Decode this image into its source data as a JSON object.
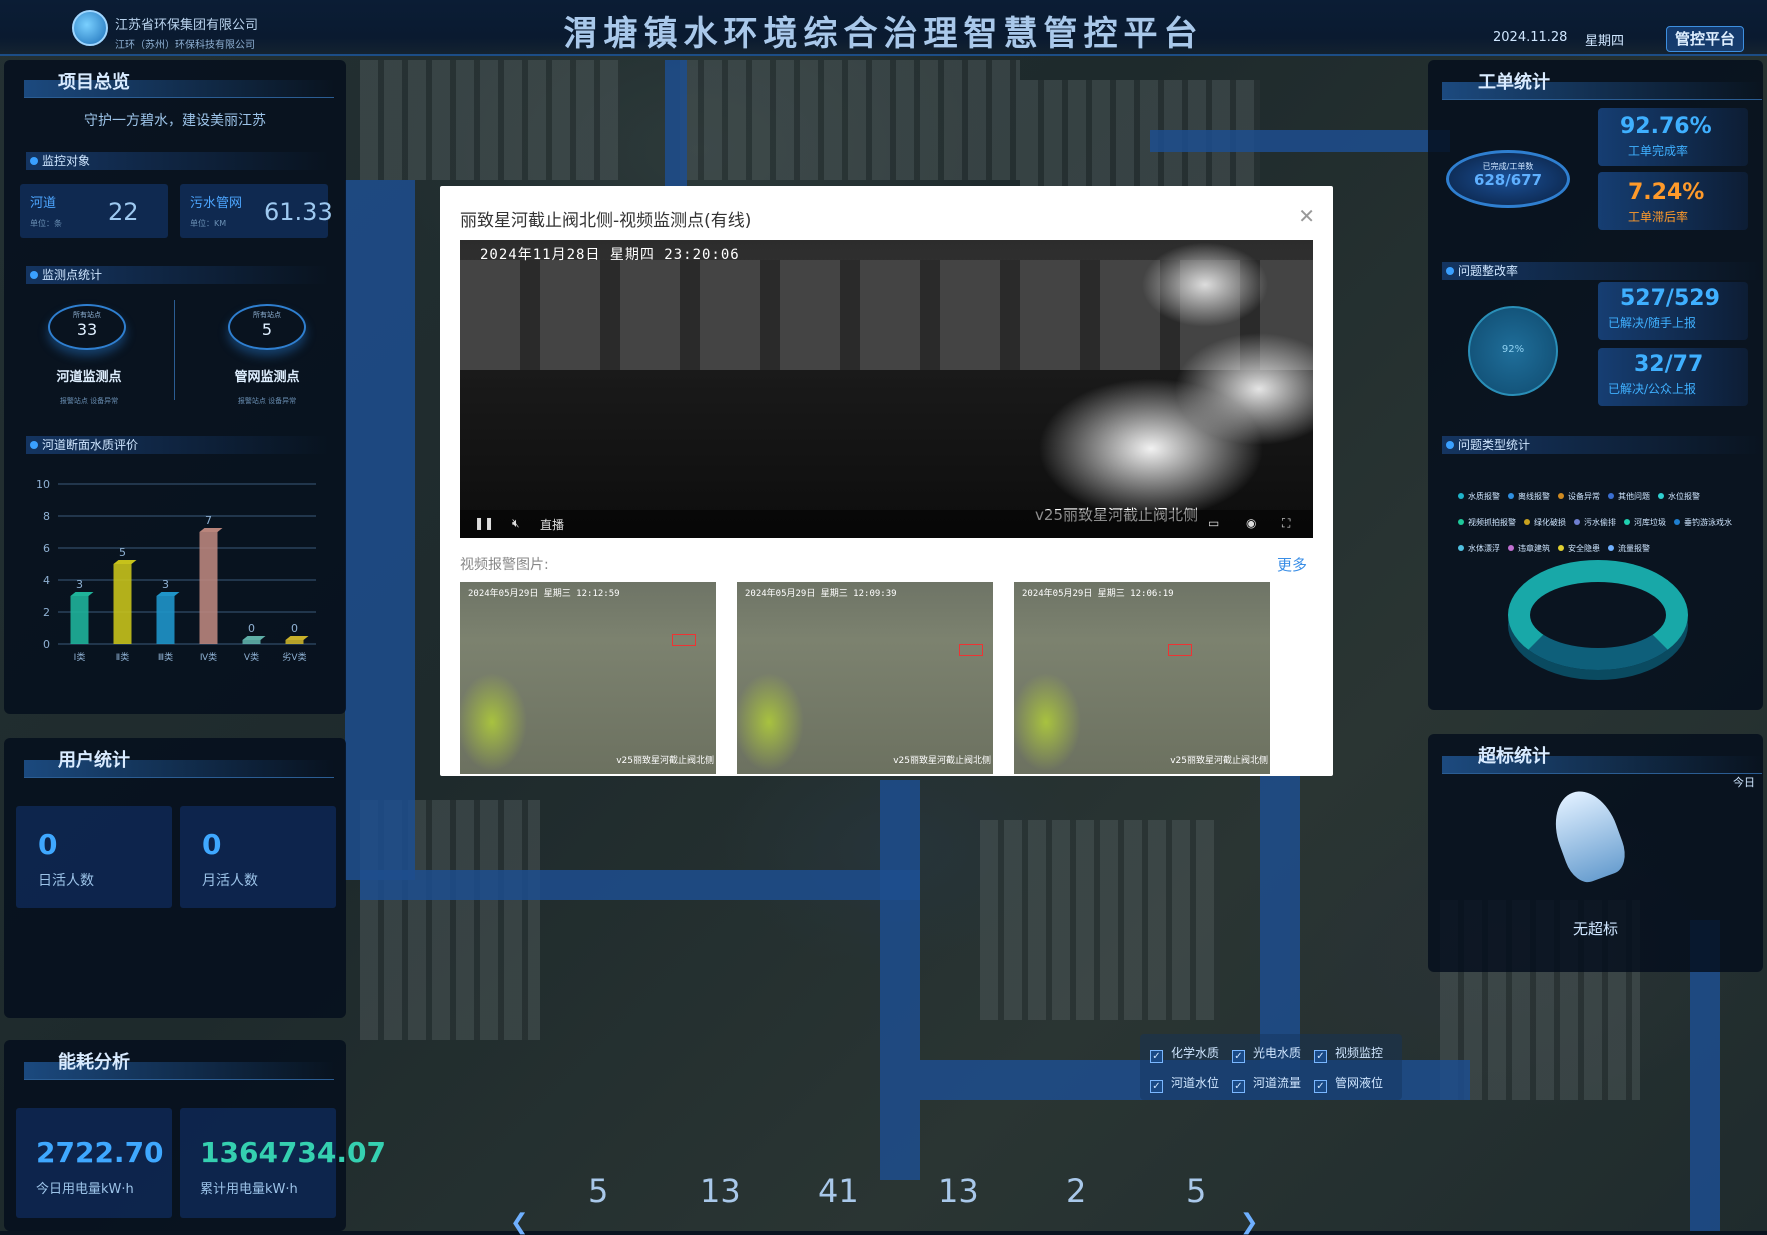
{
  "header": {
    "company1": "江苏省环保集团有限公司",
    "company2": "江环（苏州）环保科技有限公司",
    "title": "渭塘镇水环境综合治理智慧管控平台",
    "date": "2024.11.28",
    "weekday": "星期四",
    "platform_button": "管控平台"
  },
  "project": {
    "title": "项目总览",
    "slogan": "守护一方碧水，建设美丽江苏",
    "monitor": {
      "title": "监控对象",
      "items": [
        {
          "label": "河道",
          "value": "22",
          "unit": "单位：条"
        },
        {
          "label": "污水管网",
          "value": "61.33",
          "unit": "单位：KM"
        }
      ]
    },
    "points": {
      "title": "监测点统计",
      "items": [
        {
          "caption": "所有站点",
          "value": "33",
          "label": "河道监测点",
          "legend": "报警站点  设备异常"
        },
        {
          "caption": "所有站点",
          "value": "5",
          "label": "管网监测点",
          "legend": "报警站点  设备异常"
        }
      ]
    }
  },
  "quality": {
    "title": "河道断面水质评价"
  },
  "chart_data": {
    "type": "bar",
    "categories": [
      "Ⅰ类",
      "Ⅱ类",
      "Ⅲ类",
      "Ⅳ类",
      "Ⅴ类",
      "劣Ⅴ类"
    ],
    "values": [
      3,
      5,
      3,
      7,
      0,
      0
    ],
    "ylim": [
      0,
      10
    ],
    "yticks": [
      0,
      2,
      4,
      6,
      8,
      10
    ],
    "colors": [
      "#1fb39a",
      "#c6c21b",
      "#1f95c9",
      "#b9857c",
      "#5fb0a8",
      "#c9b12a"
    ]
  },
  "users": {
    "title": "用户统计",
    "daily_value": "0",
    "daily_label": "日活人数",
    "monthly_value": "0",
    "monthly_label": "月活人数"
  },
  "energy": {
    "title": "能耗分析",
    "today_value": "2722.70",
    "today_label": "今日用电量kW·h",
    "total_value": "1364734.07",
    "total_label": "累计用电量kW·h"
  },
  "workorder": {
    "title": "工单统计",
    "ring_caption": "已完成/工单数",
    "ring_value": "628/677",
    "rate1": "92.76%",
    "rate1_label": "工单完成率",
    "rate2": "7.24%",
    "rate2_label": "工单滞后率"
  },
  "rectify": {
    "title": "问题整改率",
    "percent": "92%",
    "v1": "527/529",
    "v1_label": "已解决/随手上报",
    "v2": "32/77",
    "v2_label": "已解决/公众上报"
  },
  "issuetype": {
    "title": "问题类型统计",
    "items": [
      {
        "label": "水质报警",
        "color": "#1fb3c9"
      },
      {
        "label": "离线报警",
        "color": "#2f8fe0"
      },
      {
        "label": "设备异常",
        "color": "#d08a20"
      },
      {
        "label": "其他问题",
        "color": "#3a6fd0"
      },
      {
        "label": "水位报警",
        "color": "#2fd0d0"
      },
      {
        "label": "视频抓拍报警",
        "color": "#1fc99a"
      },
      {
        "label": "绿化破损",
        "color": "#c9a21f"
      },
      {
        "label": "污水偷排",
        "color": "#6f7fd0"
      },
      {
        "label": "河库垃圾",
        "color": "#1fd0b0"
      },
      {
        "label": "垂钓游泳戏水",
        "color": "#1f7fd0"
      },
      {
        "label": "水体漂浮",
        "color": "#4fc0e0"
      },
      {
        "label": "违章建筑",
        "color": "#c06fd0"
      },
      {
        "label": "安全隐患",
        "color": "#e0d030"
      },
      {
        "label": "流量报警",
        "color": "#6fb0ff"
      }
    ]
  },
  "exceed": {
    "title": "超标统计",
    "today": "今日",
    "none": "无超标"
  },
  "modal": {
    "title": "丽致星河截止阀北侧-视频监测点(有线)",
    "timestamp": "2024年11月28日  星期四  23:20:06",
    "caption": "v25丽致星河截止阀北侧",
    "live": "直播",
    "alarm_label": "视频报警图片:",
    "more": "更多",
    "thumbs": [
      {
        "ts": "2024年05月29日  星期三  12:12:59",
        "cap": "v25丽致星河截止阀北侧"
      },
      {
        "ts": "2024年05月29日  星期三  12:09:39",
        "cap": "v25丽致星河截止阀北侧"
      },
      {
        "ts": "2024年05月29日  星期三  12:06:19",
        "cap": "v25丽致星河截止阀北侧"
      }
    ]
  },
  "layers": [
    {
      "label": "化学水质"
    },
    {
      "label": "光电水质"
    },
    {
      "label": "视频监控"
    },
    {
      "label": "河道水位"
    },
    {
      "label": "河道流量"
    },
    {
      "label": "管网液位"
    }
  ],
  "bottom_counts": [
    "5",
    "13",
    "41",
    "13",
    "2",
    "5"
  ]
}
